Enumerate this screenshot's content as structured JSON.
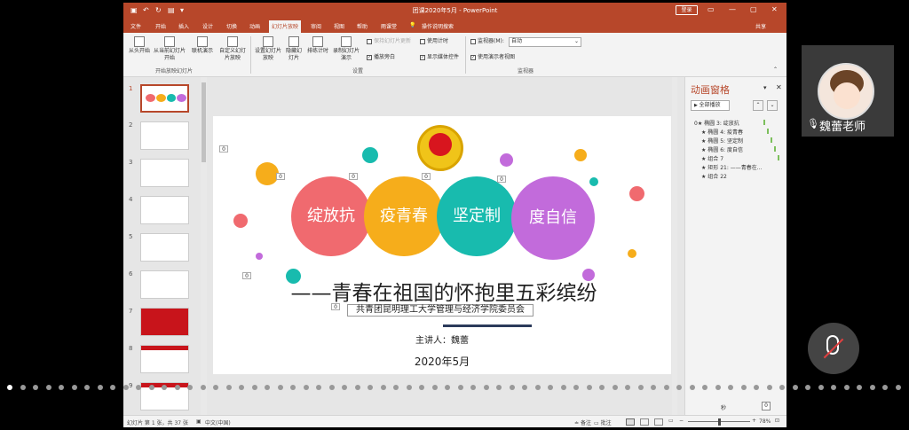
{
  "titlebar": {
    "title": "团课2020年5月  -  PowerPoint",
    "login": "登录",
    "share": "共享"
  },
  "tabs": [
    "文件",
    "开始",
    "插入",
    "设计",
    "切换",
    "动画",
    "幻灯片放映",
    "审阅",
    "视图",
    "帮助",
    "雨课堂",
    "操作说明搜索"
  ],
  "ribbon": {
    "from_start": "从头开始",
    "from_current": "从当前幻灯片开始",
    "online": "联机演示",
    "custom": "自定义幻灯片放映",
    "group_start": "开始放映幻灯片",
    "setup": "设置幻灯片放映",
    "hide": "隐藏幻灯片",
    "rehearse": "排练计时",
    "record": "录制幻灯片演示",
    "cb_keep": "保持幻灯片更新",
    "cb_timing": "使用计时",
    "cb_narration": "播放旁白",
    "cb_media": "显示媒体控件",
    "group_setup": "设置",
    "monitor_label": "监视器(M):",
    "monitor_value": "自动",
    "presenter": "使用演示者视图",
    "group_monitor": "监视器"
  },
  "thumbnails": [
    "1",
    "2",
    "3",
    "4",
    "5",
    "6",
    "7",
    "8",
    "9"
  ],
  "slide": {
    "words": [
      "绽放抗",
      "疫青春",
      "坚定制",
      "度自信"
    ],
    "title": "——青春在祖国的怀抱里五彩缤纷",
    "org": "共青团昆明理工大学管理与经济学院委员会",
    "speaker": "主讲人：魏蕾",
    "date": "2020年5月",
    "zeros": [
      "0",
      "0",
      "0",
      "0",
      "0",
      "0",
      "0"
    ]
  },
  "anim_pane": {
    "title": "动画窗格",
    "play_all": "全部播放",
    "items": [
      "0★ 椭圆 3: 绽放抗",
      "★ 椭圆 4: 疫青春",
      "★ 椭圆 5: 坚定制",
      "★ 椭圆 6: 度自信",
      "★ 组合 7",
      "★ 矩形 21: ——青春在...",
      "★ 组合 22"
    ],
    "seconds": "秒",
    "sec_value": "0"
  },
  "status": {
    "slide_info": "幻灯片 第 1 张，共 37 张",
    "lang": "中文(中国)",
    "notes": "备注",
    "comments": "批注",
    "zoom": "78%"
  },
  "camera": {
    "name": "魏蕾老师"
  },
  "colors": {
    "accent": "#b7472a",
    "red": "#f06a6f",
    "yellow": "#f6ad1b",
    "teal": "#18bbae",
    "purple": "#c26bdb"
  }
}
